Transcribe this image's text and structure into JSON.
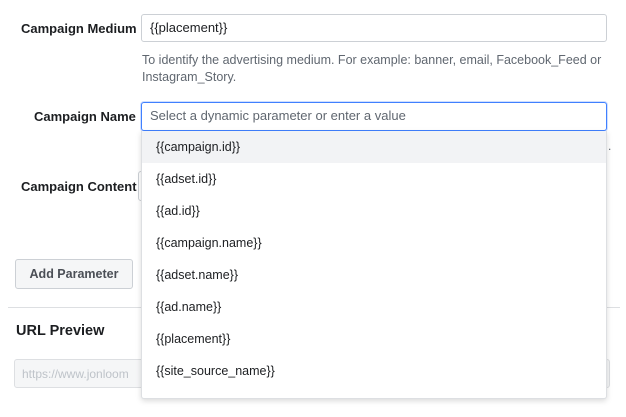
{
  "form": {
    "medium": {
      "label": "Campaign Medium",
      "value": "{{placement}}",
      "helper": "To identify the advertising medium. For example: banner, email, Facebook_Feed or Instagram_Story."
    },
    "name": {
      "label": "Campaign Name",
      "placeholder": "Select a dynamic parameter or enter a value"
    },
    "content": {
      "label": "Campaign Content"
    },
    "add_parameter_label": "Add Parameter",
    "helper_fragment": "."
  },
  "dropdown": {
    "options": [
      "{{campaign.id}}",
      "{{adset.id}}",
      "{{ad.id}}",
      "{{campaign.name}}",
      "{{adset.name}}",
      "{{ad.name}}",
      "{{placement}}",
      "{{site_source_name}}"
    ],
    "highlighted_index": 0
  },
  "preview": {
    "title": "URL Preview",
    "url": "https://www.jonloom"
  },
  "colors": {
    "focus_border": "#4080ff",
    "highlight_bg": "#f2f3f5",
    "text": "#1c1e21",
    "muted_text": "#606770"
  }
}
